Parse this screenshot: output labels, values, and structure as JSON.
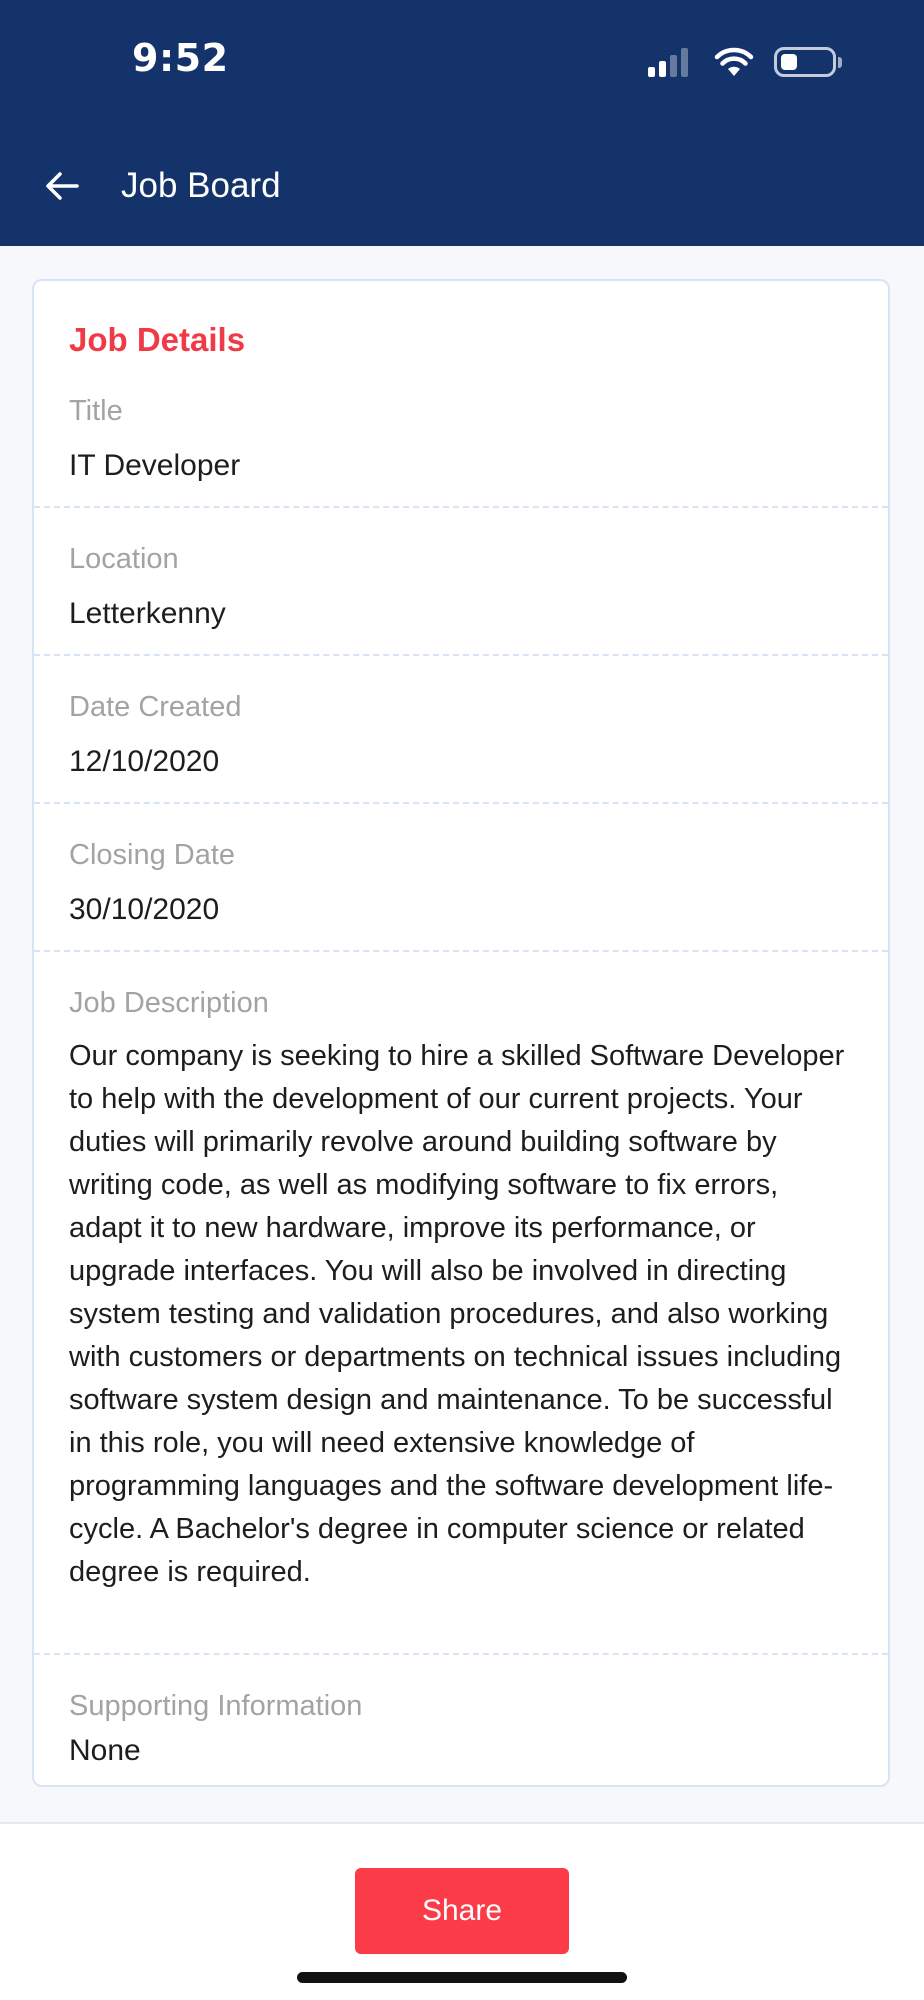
{
  "status_bar": {
    "time": "9:52"
  },
  "nav": {
    "title": "Job Board",
    "back_icon": "arrow-left-icon"
  },
  "job": {
    "heading": "Job Details",
    "title_label": "Title",
    "title_value": "IT Developer",
    "location_label": "Location",
    "location_value": "Letterkenny",
    "date_created_label": "Date Created",
    "date_created_value": "12/10/2020",
    "closing_date_label": "Closing Date",
    "closing_date_value": "30/10/2020",
    "description_label": "Job Description",
    "description_value": "Our company is seeking to hire a skilled Software Developer to help with the development of our current projects. Your duties will primarily revolve around building software by writing code, as well as modifying software to fix errors, adapt it to new hardware, improve its performance, or upgrade interfaces. You will also be involved in directing system testing and validation procedures, and also working with customers or departments on technical issues including software system design and maintenance. To be successful in this role, you will need extensive knowledge of programming languages and the software development life-cycle. A Bachelor's degree in computer science or related degree is required.",
    "supporting_label": "Supporting Information",
    "supporting_value": "None"
  },
  "actions": {
    "share_label": "Share"
  },
  "colors": {
    "header_bg": "#15336b",
    "accent_red": "#f03a47",
    "button_red": "#fb3b47"
  }
}
